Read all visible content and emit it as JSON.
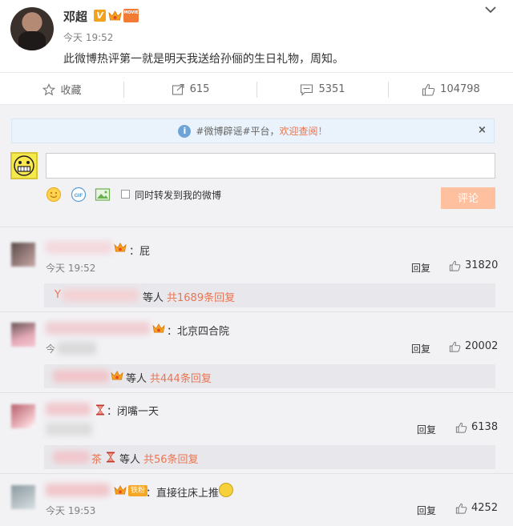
{
  "post": {
    "author": "邓超",
    "v_badge": "V",
    "movie_badge": "MOVIE",
    "time": "今天 19:52",
    "text": "此微博热评第一就是明天我送给孙俪的生日礼物，周知。"
  },
  "actions": {
    "favorite_label": "收藏",
    "repost_count": "615",
    "comment_count": "5351",
    "like_count": "104798"
  },
  "notice": {
    "info_glyph": "i",
    "prefix": "#微博辟谣#平台，",
    "link": "欢迎查阅！",
    "close": "×"
  },
  "composer": {
    "input_value": "",
    "forward_label": "同时转发到我的微博",
    "submit_label": "评论",
    "gif_label": "GIF"
  },
  "comments": [
    {
      "text": "：屁",
      "time": "今天 19:52",
      "reply_label": "回复",
      "likes": "31820",
      "sub": {
        "name_fragment": "Y",
        "middle": "等人",
        "count_label": "共1689条回复"
      }
    },
    {
      "text": "：北京四合院",
      "time": "今",
      "reply_label": "回复",
      "likes": "20002",
      "sub": {
        "name_fragment": "",
        "middle": "等人",
        "count_label": "共444条回复"
      }
    },
    {
      "text": "：闭嘴一天",
      "time": "",
      "reply_label": "回复",
      "likes": "6138",
      "sub": {
        "name_fragment": "茶",
        "middle": "等人",
        "count_label": "共56条回复"
      }
    },
    {
      "text": "：直接往床上推",
      "time": "今天 19:53",
      "reply_label": "回复",
      "likes": "4252",
      "badge": "铁粉"
    }
  ],
  "colors": {
    "accent": "#eb7350",
    "submit": "#ffc09f",
    "comment_bg": "#f2f2f5",
    "sub_bar": "#e8e8ec"
  },
  "icons": [
    "chevron-down-icon",
    "star-icon",
    "repost-icon",
    "comment-icon",
    "thumbs-up-icon",
    "info-icon",
    "smile-icon",
    "gif-icon",
    "image-icon",
    "crown-icon",
    "hourglass-icon"
  ]
}
